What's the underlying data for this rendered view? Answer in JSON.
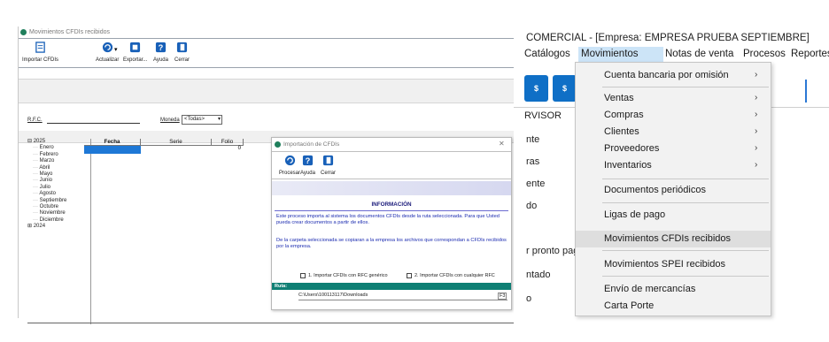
{
  "cfdi_window": {
    "title": "Movimientos CFDIs recibidos",
    "toolbar": [
      {
        "label": "Importar CFDIs",
        "icon": "document-icon"
      },
      {
        "label": "Actualizar",
        "icon": "refresh-icon"
      },
      {
        "label": "Exportar...",
        "icon": "export-icon"
      },
      {
        "label": "Ayuda",
        "icon": "help-icon"
      },
      {
        "label": "Cerrar",
        "icon": "close-door-icon"
      }
    ],
    "filter": {
      "rfc_label": "R.F.C.",
      "moneda_label": "Moneda",
      "moneda_value": "<Todas>"
    },
    "tree": {
      "years": [
        {
          "label": "2025",
          "months": [
            "Enero",
            "Febrero",
            "Marzo",
            "Abril",
            "Mayo",
            "Junio",
            "Julio",
            "Agosto",
            "Septiembre",
            "Octubre",
            "Noviembre",
            "Diciembre"
          ]
        },
        {
          "label": "2024",
          "months": []
        }
      ]
    },
    "grid": {
      "columns": [
        "Fecha",
        "Serie",
        "Folio"
      ],
      "row": {
        "fecha": "",
        "serie": "",
        "folio": "0"
      }
    }
  },
  "dialog": {
    "title": "Importación de CFDIs",
    "close_symbol": "✕",
    "toolbar": [
      {
        "label": "Procesar",
        "icon": "process-icon"
      },
      {
        "label": "Ayuda",
        "icon": "help-icon"
      },
      {
        "label": "Cerrar",
        "icon": "close-door-icon"
      }
    ],
    "info_title": "INFORMACIÓN",
    "info_text_1": "Este proceso importa al sistema los documentos CFDIs desde la ruta seleccionada. Para que Usted pueda crear documentos a partir de ellos.",
    "info_text_2": "De la carpeta seleccionada se copiaran a la empresa los archivos que correspondan a CFDIs recibidos por la empresa.",
    "check_1": "1. Importar CFDIs con RFC genérico",
    "check_2": "2. Importar CFDIs con cualquier RFC",
    "ruta_label": "Ruta:",
    "ruta_value": "C:\\Users\\100113117\\Downloads",
    "f3_label": "F3"
  },
  "comercial": {
    "title": "COMERCIAL - [Empresa: EMPRESA PRUEBA SEPTIEMBRE]",
    "menubar": [
      "Catálogos",
      "Movimientos",
      "Notas de venta",
      "Procesos",
      "Reportes"
    ],
    "active_menu": "Movimientos",
    "side_header": "RVISOR",
    "side_labels": [
      "nte",
      "ras",
      "ente",
      "do",
      "r pronto pago",
      "ntado",
      "o"
    ],
    "tiles": [
      "$",
      "$"
    ]
  },
  "menu": {
    "items": [
      {
        "label": "Cuenta bancaria por omisión",
        "submenu": true
      },
      {
        "label": "Ventas",
        "submenu": true
      },
      {
        "label": "Compras",
        "submenu": true
      },
      {
        "label": "Clientes",
        "submenu": true
      },
      {
        "label": "Proveedores",
        "submenu": true
      },
      {
        "label": "Inventarios",
        "submenu": true
      },
      {
        "label": "Documentos periódicos",
        "submenu": false
      },
      {
        "label": "Ligas de pago",
        "submenu": false
      },
      {
        "label": "Movimientos CFDIs recibidos",
        "submenu": false,
        "highlighted": true
      },
      {
        "label": "Movimientos SPEI recibidos",
        "submenu": false
      },
      {
        "label": "Envío de mercancías",
        "submenu": false
      },
      {
        "label": "Carta Porte",
        "submenu": false
      }
    ],
    "arrow": "›"
  },
  "colors": {
    "accent_blue": "#0f6fc6",
    "teal_bar": "#0f7f74",
    "menu_highlight": "#dedede",
    "menubar_active": "#cce4f7"
  }
}
